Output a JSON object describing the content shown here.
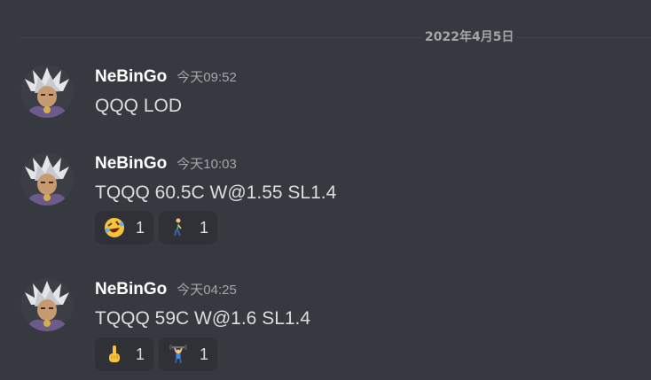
{
  "date_divider": "2022年4月5日",
  "messages": [
    {
      "username": "NeBinGo",
      "timestamp": "今天09:52",
      "content": "QQQ LOD",
      "reactions": []
    },
    {
      "username": "NeBinGo",
      "timestamp": "今天10:03",
      "content": "TQQQ 60.5C W@1.55 SL1.4",
      "reactions": [
        {
          "emoji": "rolling-on-floor-laughing-icon",
          "count": "1"
        },
        {
          "emoji": "person-walking-icon",
          "count": "1"
        }
      ]
    },
    {
      "username": "NeBinGo",
      "timestamp": "今天04:25",
      "content": "TQQQ 59C W@1.6 SL1.4",
      "reactions": [
        {
          "emoji": "index-pointing-up-icon",
          "count": "1"
        },
        {
          "emoji": "person-lifting-weights-icon",
          "count": "1"
        }
      ]
    }
  ],
  "colors": {
    "background": "#36393f",
    "reaction_bg": "#2f3136",
    "username": "#ffffff",
    "timestamp": "#a3a6aa",
    "text": "#dcddde"
  }
}
